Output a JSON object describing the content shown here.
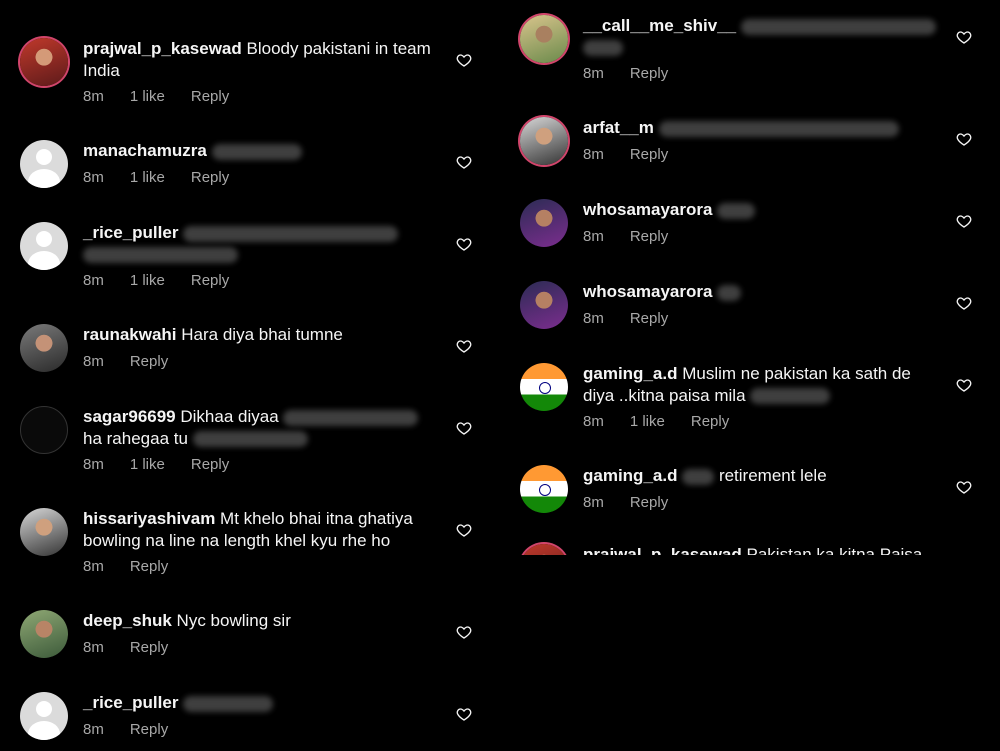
{
  "left_comments": [
    {
      "username": "prajwal_p_kasewad",
      "text": "Bloody pakistani in team India",
      "time": "8m",
      "likes": "1 like",
      "reply": "Reply"
    },
    {
      "username": "manachamuzra",
      "text": "",
      "time": "8m",
      "likes": "1 like",
      "reply": "Reply"
    },
    {
      "username": "_rice_puller",
      "text": "",
      "time": "8m",
      "likes": "1 like",
      "reply": "Reply"
    },
    {
      "username": "raunakwahi",
      "text": "Hara diya bhai tumne",
      "time": "8m",
      "likes": "",
      "reply": "Reply"
    },
    {
      "username": "sagar96699",
      "text": "Dikhaa diyaa",
      "text2": "ha rahegaa tu",
      "time": "8m",
      "likes": "1 like",
      "reply": "Reply"
    },
    {
      "username": "hissariyashivam",
      "text": "Mt khelo bhai itna ghatiya bowling na line na length khel kyu rhe ho",
      "time": "8m",
      "likes": "",
      "reply": "Reply"
    },
    {
      "username": "deep_shuk",
      "text": "Nyc bowling sir",
      "time": "8m",
      "likes": "",
      "reply": "Reply"
    },
    {
      "username": "_rice_puller",
      "text": "",
      "time": "8m",
      "likes": "",
      "reply": "Reply"
    }
  ],
  "right_comments": [
    {
      "username": "__call__me_shiv__",
      "text": "",
      "time": "8m",
      "likes": "",
      "reply": "Reply"
    },
    {
      "username": "arfat__m",
      "text": "",
      "time": "8m",
      "likes": "",
      "reply": "Reply"
    },
    {
      "username": "whosamayarora",
      "text": "",
      "time": "8m",
      "likes": "",
      "reply": "Reply"
    },
    {
      "username": "whosamayarora",
      "text": "",
      "time": "8m",
      "likes": "",
      "reply": "Reply"
    },
    {
      "username": "gaming_a.d",
      "text": "Muslim ne pakistan ka sath de diya ..kitna paisa mila",
      "time": "8m",
      "likes": "1 like",
      "reply": "Reply"
    },
    {
      "username": "gaming_a.d",
      "text": "retirement lele",
      "time": "8m",
      "likes": "",
      "reply": "Reply"
    },
    {
      "username": "prajwal_p_kasewad",
      "text": "Pakistan ka kitna Paisa",
      "time": "",
      "likes": "",
      "reply": ""
    }
  ],
  "icons": {
    "like": "heart-outline-icon",
    "avatar_default": "default-avatar-icon"
  },
  "colors": {
    "background": "#000000",
    "text": "#f5f5f5",
    "meta": "#a8a8a8",
    "ring": "#d1456b"
  }
}
